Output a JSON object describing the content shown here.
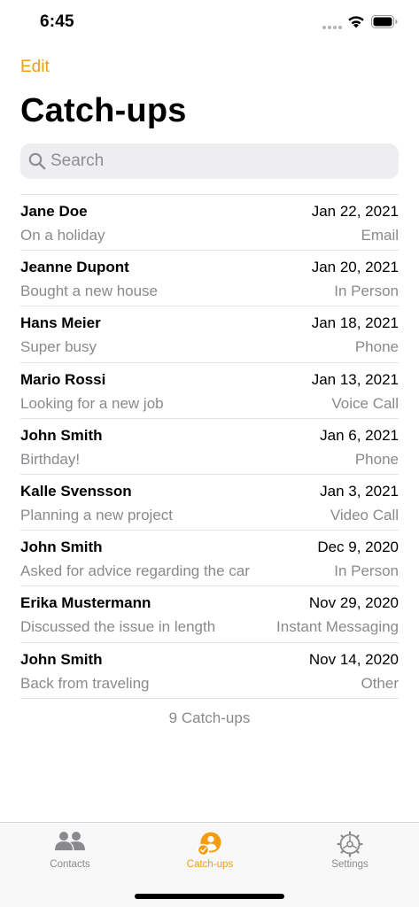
{
  "status_bar": {
    "time": "6:45"
  },
  "nav": {
    "edit_label": "Edit",
    "title": "Catch-ups"
  },
  "search": {
    "placeholder": "Search"
  },
  "catchups": [
    {
      "name": "Jane Doe",
      "date": "Jan 22, 2021",
      "note": "On a holiday",
      "type": "Email"
    },
    {
      "name": "Jeanne Dupont",
      "date": "Jan 20, 2021",
      "note": "Bought a new house",
      "type": "In Person"
    },
    {
      "name": "Hans Meier",
      "date": "Jan 18, 2021",
      "note": "Super busy",
      "type": "Phone"
    },
    {
      "name": "Mario Rossi",
      "date": "Jan 13, 2021",
      "note": "Looking for a new job",
      "type": "Voice Call"
    },
    {
      "name": "John Smith",
      "date": "Jan 6, 2021",
      "note": "Birthday!",
      "type": "Phone"
    },
    {
      "name": "Kalle Svensson",
      "date": "Jan 3, 2021",
      "note": "Planning a new project",
      "type": "Video Call"
    },
    {
      "name": "John Smith",
      "date": "Dec 9, 2020",
      "note": "Asked for advice regarding the car",
      "type": "In Person"
    },
    {
      "name": "Erika Mustermann",
      "date": "Nov 29, 2020",
      "note": "Discussed the issue in length",
      "type": "Instant Messaging"
    },
    {
      "name": "John Smith",
      "date": "Nov 14, 2020",
      "note": "Back from traveling",
      "type": "Other"
    }
  ],
  "footer": {
    "count_label": "9 Catch-ups"
  },
  "tab_bar": {
    "tabs": [
      {
        "label": "Contacts",
        "icon": "contacts-icon",
        "active": false
      },
      {
        "label": "Catch-ups",
        "icon": "catch-ups-icon",
        "active": true
      },
      {
        "label": "Settings",
        "icon": "gear-icon",
        "active": false
      }
    ]
  },
  "colors": {
    "accent": "#f39c12",
    "secondary_text": "#8a8a8e",
    "separator": "#e4e4e6",
    "tab_inactive": "#8a8a8e"
  }
}
